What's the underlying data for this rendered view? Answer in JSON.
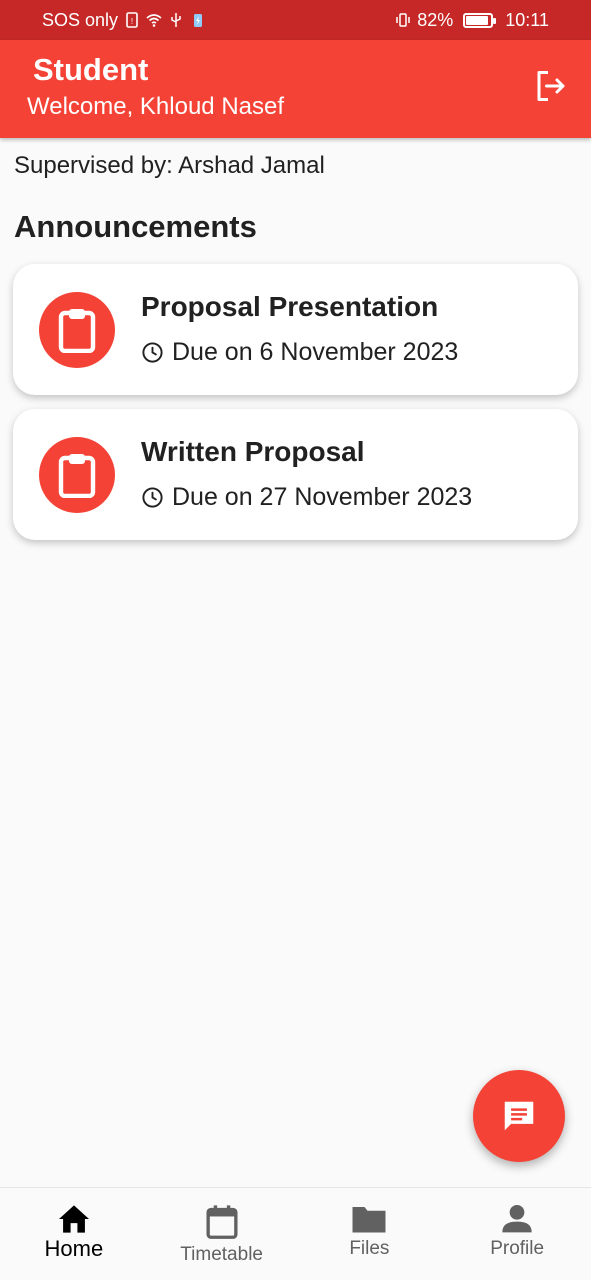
{
  "status_bar": {
    "carrier": "SOS only",
    "battery": "82%",
    "battery_level": 0.82,
    "time": "10:11"
  },
  "app_bar": {
    "title": "Student",
    "subtitle": "Welcome, Khloud Nasef",
    "action_icon": "logout-icon"
  },
  "supervisor": "Supervised by: Arshad Jamal",
  "announcements": {
    "heading": "Announcements",
    "items": [
      {
        "title": "Proposal Presentation",
        "due": "Due on 6 November 2023",
        "icon": "clipboard-icon"
      },
      {
        "title": "Written Proposal",
        "due": "Due on 27 November 2023",
        "icon": "clipboard-icon"
      }
    ]
  },
  "fab": {
    "icon": "chat-icon"
  },
  "bottom_nav": {
    "items": [
      {
        "label": "Home",
        "icon": "home-icon",
        "active": true
      },
      {
        "label": "Timetable",
        "icon": "calendar-icon",
        "active": false
      },
      {
        "label": "Files",
        "icon": "folder-icon",
        "active": false
      },
      {
        "label": "Profile",
        "icon": "person-icon",
        "active": false
      }
    ]
  },
  "colors": {
    "primary": "#f44336",
    "status_bar": "#c62828",
    "background": "#fafafa"
  }
}
